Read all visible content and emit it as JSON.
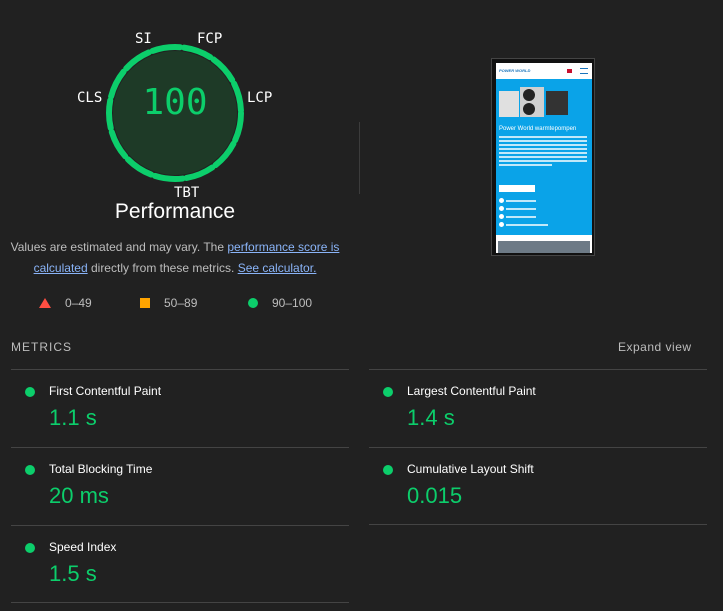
{
  "gauge": {
    "score": "100",
    "labels": {
      "si": "SI",
      "fcp": "FCP",
      "cls": "CLS",
      "lcp": "LCP",
      "tbt": "TBT"
    },
    "title": "Performance",
    "color": "#0cce6b"
  },
  "description": {
    "before": "Values are estimated and may vary. The ",
    "link1": "performance score is calculated",
    "middle": " directly from these metrics. ",
    "link2": "See calculator."
  },
  "legend": [
    {
      "range": "0–49",
      "shape": "triangle-icon",
      "color": "#ff4e42"
    },
    {
      "range": "50–89",
      "shape": "square-icon",
      "color": "#ffa400"
    },
    {
      "range": "90–100",
      "shape": "circle-icon",
      "color": "#0cce6b"
    }
  ],
  "thumbnail": {
    "logo": "POWER WORLD",
    "heading": "Power World warmtepompen"
  },
  "metrics": {
    "heading": "METRICS",
    "expand": "Expand view",
    "items": [
      {
        "name": "First Contentful Paint",
        "value": "1.1 s"
      },
      {
        "name": "Largest Contentful Paint",
        "value": "1.4 s"
      },
      {
        "name": "Total Blocking Time",
        "value": "20 ms"
      },
      {
        "name": "Cumulative Layout Shift",
        "value": "0.015"
      },
      {
        "name": "Speed Index",
        "value": "1.5 s"
      }
    ]
  }
}
